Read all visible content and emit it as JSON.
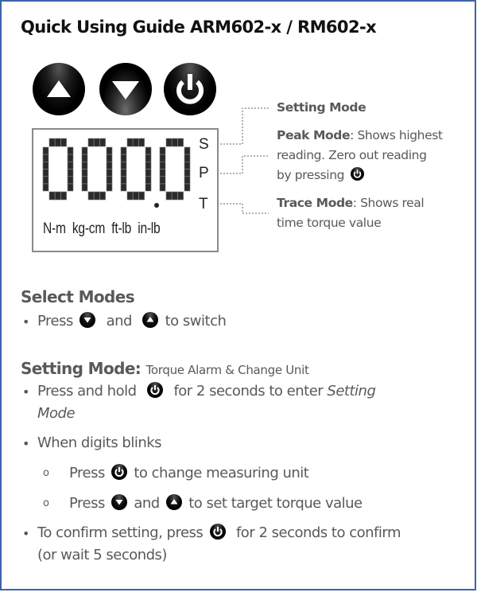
{
  "title": "Quick Using Guide ARM602-x / RM602-x",
  "device_buttons": [
    {
      "name": "up",
      "icon": "triangle-up-icon"
    },
    {
      "name": "down",
      "icon": "triangle-down-icon"
    },
    {
      "name": "power",
      "icon": "power-icon"
    }
  ],
  "lcd": {
    "display_value": "000.0",
    "mode_letters": [
      "S",
      "P",
      "T"
    ],
    "units": [
      "N-m",
      "kg-cm",
      "ft-lb",
      "in-lb"
    ]
  },
  "mode_labels": {
    "setting": {
      "title": "Setting Mode"
    },
    "peak": {
      "title": "Peak Mode",
      "desc_1": ": Shows highest",
      "desc_2": "reading. Zero out reading",
      "desc_3": "by pressing"
    },
    "trace": {
      "title": "Trace Mode",
      "desc_1": ": Shows real",
      "desc_2": "time torque value"
    }
  },
  "select_modes": {
    "heading": "Select Modes",
    "bullet_1": {
      "press": "Press",
      "and": "and",
      "tail": "to switch"
    }
  },
  "setting_mode": {
    "heading": "Setting Mode:",
    "subheading": "Torque Alarm & Change Unit",
    "bullet_1": {
      "pre": "Press and hold",
      "post": "for 2 seconds to enter",
      "italic_1": "Setting",
      "italic_2": "Mode"
    },
    "bullet_2": {
      "text": "When digits blinks"
    },
    "sub_1": {
      "press": "Press",
      "tail": "to change measuring unit"
    },
    "sub_2": {
      "press": "Press",
      "and": "and",
      "tail": "to set target torque value"
    },
    "bullet_3": {
      "pre": "To confirm setting, press",
      "post": "for 2 seconds to confirm",
      "line_2": "(or wait 5 seconds)"
    }
  },
  "markers": {
    "bullet": "•",
    "sub_bullet": "o"
  },
  "colors": {
    "frame": "#3e63a8",
    "text": "#595959",
    "title": "#111111"
  }
}
